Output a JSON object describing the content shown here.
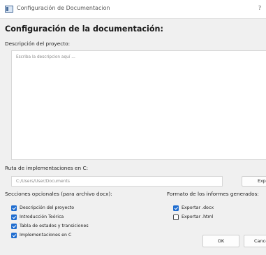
{
  "window": {
    "title": "Configuración de Documentacion",
    "help_label": "?"
  },
  "dialog": {
    "heading": "Configuración de la documentación:",
    "description_label": "Descripción del proyecto:",
    "description_placeholder": "Escriba la descripcion aquí ...",
    "path_label": "Ruta de implementaciones en C:",
    "path_value": "C:/Users/User/Documents",
    "browse_label": "Explora",
    "optional_sections_label": "Secciones opcionales (para archivo docx):",
    "optional_sections": [
      {
        "label": "Descripción del proyecto",
        "checked": true
      },
      {
        "label": "Introducción Teórica",
        "checked": true
      },
      {
        "label": "Tabla de estados y transiciones",
        "checked": true
      },
      {
        "label": "Implementaciones en C",
        "checked": true
      }
    ],
    "format_label": "Formato de los informes generados:",
    "formats": [
      {
        "label": "Exportar .docx",
        "checked": true
      },
      {
        "label": "Exportar .html",
        "checked": false
      }
    ],
    "ok_label": "OK",
    "cancel_label": "Cancel"
  },
  "colors": {
    "accent": "#1f6dd0",
    "panel_bg": "#f0f0f0"
  }
}
